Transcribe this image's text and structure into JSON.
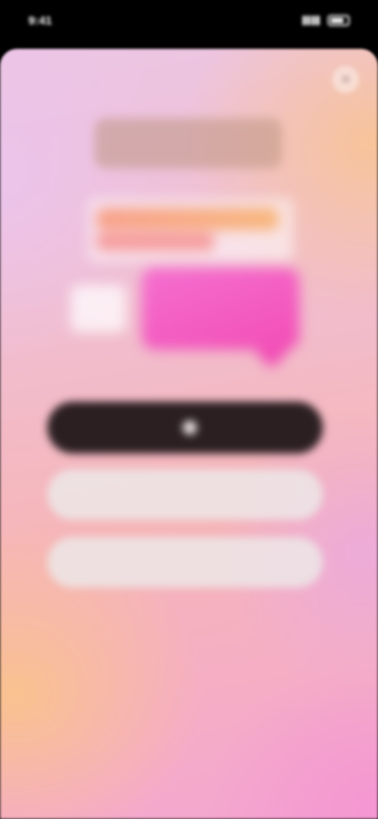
{
  "status_bar": {
    "time": "9:41"
  },
  "close_button": {
    "icon": "close-icon",
    "glyph": "✕"
  },
  "logo": {
    "text": ""
  },
  "buttons": {
    "primary_label": "",
    "secondary_label": "",
    "tertiary_label": ""
  },
  "colors": {
    "primary_button": "#2b1f22",
    "secondary_button": "#ece8e8",
    "accent_pink": "#f24eb6",
    "accent_orange": "#f7a08a"
  }
}
